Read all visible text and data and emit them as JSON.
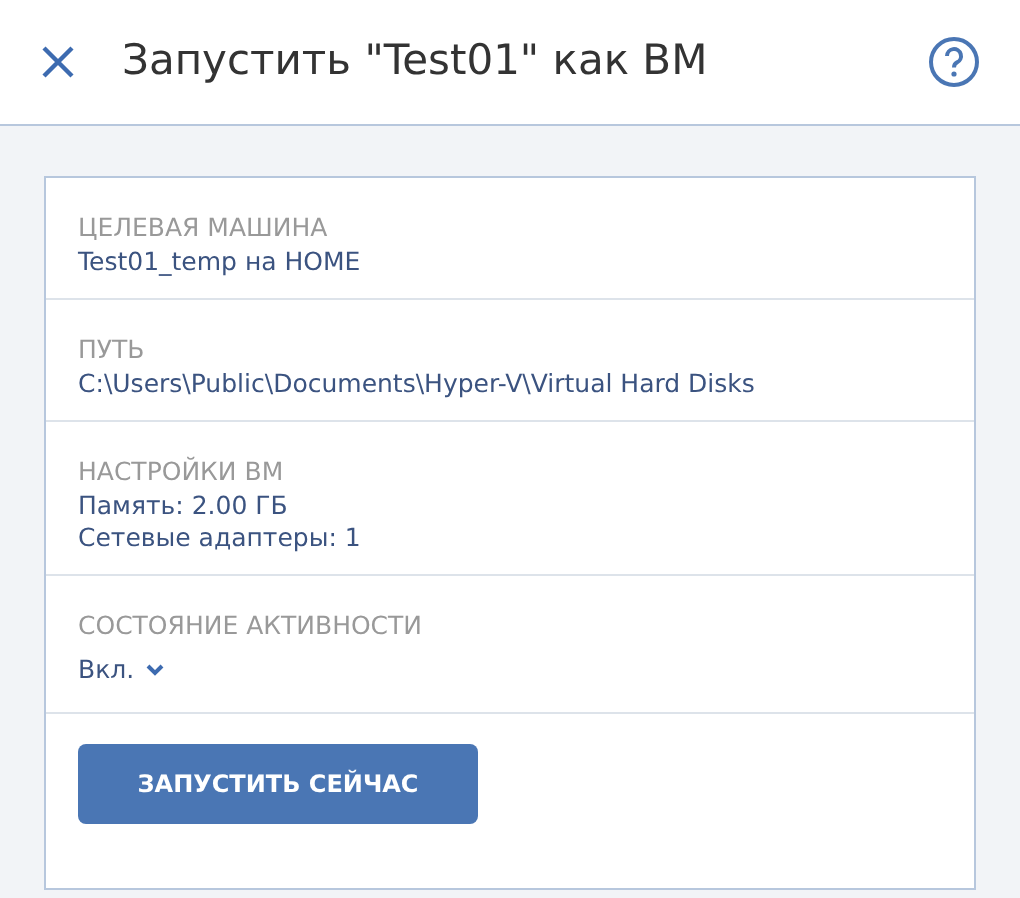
{
  "header": {
    "title": "Запустить \"Test01\" как ВМ"
  },
  "sections": [
    {
      "kind": "text",
      "label": "ЦЕЛЕВАЯ МАШИНА",
      "values": [
        "Test01_temp на HOME"
      ]
    },
    {
      "kind": "text",
      "label": "ПУТЬ",
      "values": [
        "C:\\Users\\Public\\Documents\\Hyper-V\\Virtual Hard Disks"
      ]
    },
    {
      "kind": "text",
      "label": "НАСТРОЙКИ ВМ",
      "values": [
        "Память: 2.00 ГБ",
        "Сетевые адаптеры: 1"
      ]
    },
    {
      "kind": "dropdown",
      "label": "СОСТОЯНИЕ АКТИВНОСТИ",
      "values": [
        "Вкл."
      ]
    }
  ],
  "buttons": [
    {
      "label": "ЗАПУСТИТЬ СЕЙЧАС"
    }
  ]
}
